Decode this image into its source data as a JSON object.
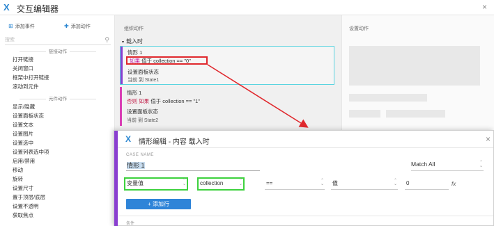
{
  "window": {
    "title": "交互编辑器",
    "logo_glyph": "X",
    "close_glyph": "×"
  },
  "left_panel": {
    "tabs": [
      {
        "label": "添加事件",
        "icon": "add-event-icon"
      },
      {
        "label": "添加动作",
        "icon": "add-action-icon"
      }
    ],
    "search_placeholder": "搜索",
    "sections": [
      {
        "title": "链接动作",
        "items": [
          "打开链接",
          "关闭窗口",
          "框架中打开链接",
          "滚动到元件"
        ]
      },
      {
        "title": "元件动作",
        "items": [
          "显示/隐藏",
          "设置面板状态",
          "设置文本",
          "设置图片",
          "设置选中",
          "设置列表选中项",
          "启用/禁用",
          "移动",
          "旋转",
          "设置尺寸",
          "置于顶层/底层",
          "设置不透明",
          "获取焦点"
        ]
      }
    ]
  },
  "middle_panel": {
    "header": "组织动作",
    "event": "载入时",
    "cases": [
      {
        "name": "情形 1",
        "keyword": "如果",
        "condition": "值于 collection == \"0\"",
        "action": "设置面板状态",
        "detail": "当前 到 State1",
        "bar_color": "#8a3fd0"
      },
      {
        "name": "情形 1",
        "keyword": "否则 如果",
        "condition": "值于 collection == \"1\"",
        "action": "设置面板状态",
        "detail": "当前 到 State2",
        "bar_color": "#d93fb5"
      }
    ]
  },
  "right_panel": {
    "header": "设置动作"
  },
  "dialog": {
    "title": "情形编辑  -  内容 载入时",
    "case_name_label": "CASE NAME",
    "case_name_value": "情形 1",
    "match_value": "Match All",
    "condition_row": {
      "type": "变量值",
      "variable": "collection",
      "operator": "==",
      "value_type": "值",
      "value": "0",
      "fx": "fx"
    },
    "add_row_label": "+ 添加行",
    "conditions_label": "条件"
  },
  "colors": {
    "accent": "#2e84d8",
    "highlight_red": "#e0282d",
    "highlight_cyan": "#5ad4e0",
    "highlight_green": "#3dd13d"
  }
}
